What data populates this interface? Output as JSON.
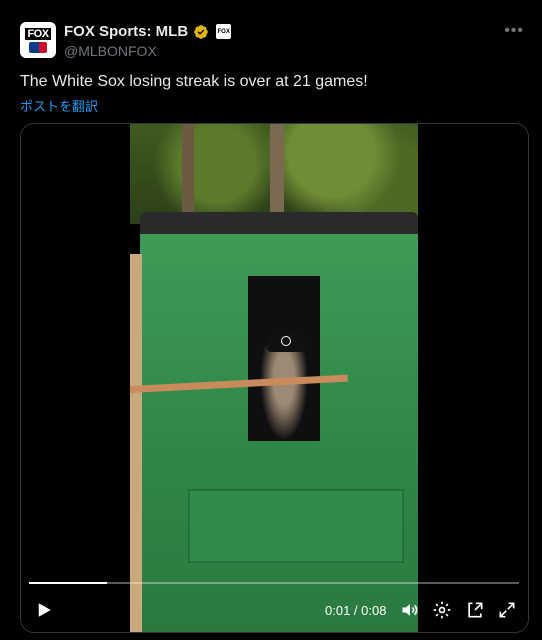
{
  "author": {
    "display_name": "FOX Sports: MLB",
    "handle": "@MLBONFOX",
    "avatar_text": "FOX",
    "affiliate_badge_text": "FOX"
  },
  "tweet": {
    "text": "The White Sox losing streak is over at 21 games!",
    "translate_label": "ポストを翻訳"
  },
  "video": {
    "time_display": "0:01 / 0:08",
    "progress_fraction": 0.16,
    "controls": [
      "play-icon",
      "volume-icon",
      "settings-icon",
      "docked-player-icon",
      "fullscreen-icon"
    ]
  },
  "colors": {
    "accent": "#1d9bf0",
    "verified": "#e2b719",
    "text_primary": "#e7e9ea",
    "text_secondary": "#71767b"
  }
}
